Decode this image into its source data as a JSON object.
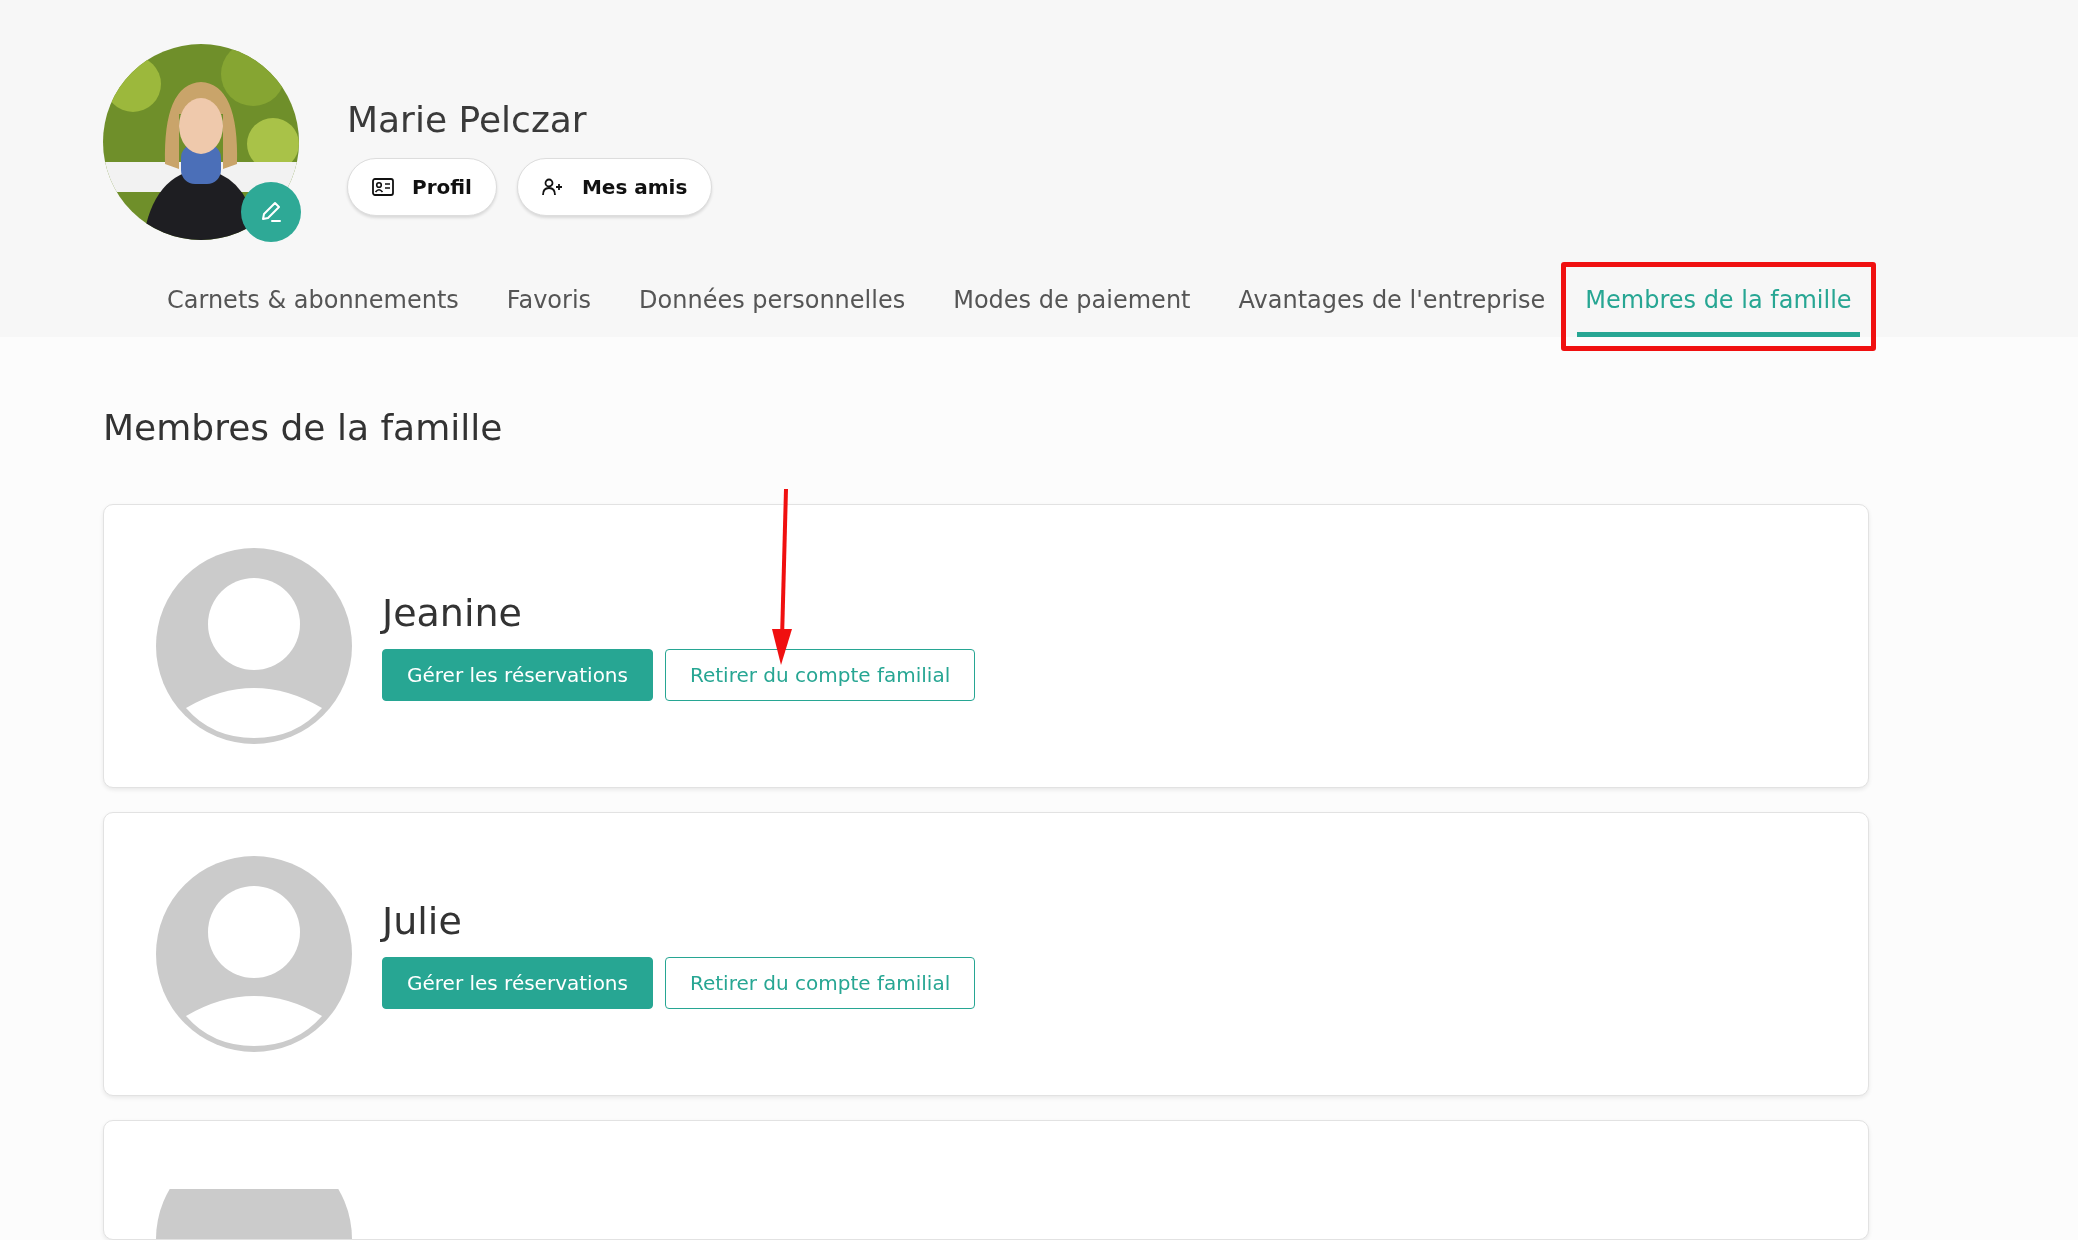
{
  "profile": {
    "name": "Marie Pelczar",
    "buttons": [
      {
        "label": "Profil",
        "kind": "card"
      },
      {
        "label": "Mes amis",
        "kind": "add-person"
      }
    ]
  },
  "tabs": [
    {
      "label": "Carnets & abonnements",
      "selected": false
    },
    {
      "label": "Favoris",
      "selected": false
    },
    {
      "label": "Données personnelles",
      "selected": false
    },
    {
      "label": "Modes de paiement",
      "selected": false
    },
    {
      "label": "Avantages de l'entreprise",
      "selected": false
    },
    {
      "label": "Membres de la famille",
      "selected": true
    }
  ],
  "section": {
    "title": "Membres de la famille"
  },
  "members": [
    {
      "kind": "member",
      "name": "Jeanine",
      "manage": "Gérer les réservations",
      "remove": "Retirer du compte familial"
    },
    {
      "kind": "member",
      "name": "Julie",
      "manage": "Gérer les réservations",
      "remove": "Retirer du compte familial"
    },
    {
      "kind": "partial"
    }
  ]
}
